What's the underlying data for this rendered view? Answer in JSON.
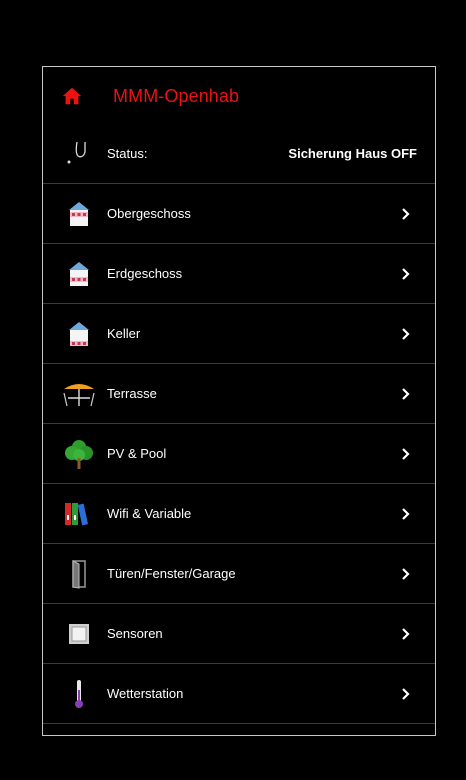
{
  "header": {
    "title": "MMM-Openhab",
    "icon": "home-icon"
  },
  "status": {
    "label": "Status:",
    "value": "Sicherung Haus OFF",
    "icon": "alarm-icon"
  },
  "items": [
    {
      "label": "Obergeschoss",
      "icon": "house-icon"
    },
    {
      "label": "Erdgeschoss",
      "icon": "house-icon"
    },
    {
      "label": "Keller",
      "icon": "house-icon"
    },
    {
      "label": "Terrasse",
      "icon": "parasol-table-icon"
    },
    {
      "label": "PV & Pool",
      "icon": "tree-icon"
    },
    {
      "label": "Wifi & Variable",
      "icon": "binders-icon"
    },
    {
      "label": "Türen/Fenster/Garage",
      "icon": "door-icon"
    },
    {
      "label": "Sensoren",
      "icon": "frame-icon"
    },
    {
      "label": "Wetterstation",
      "icon": "thermometer-icon"
    }
  ],
  "colors": {
    "accent": "#ee1111",
    "background": "#000000",
    "border": "#c8c8c8",
    "divider": "#3a3a3a"
  }
}
